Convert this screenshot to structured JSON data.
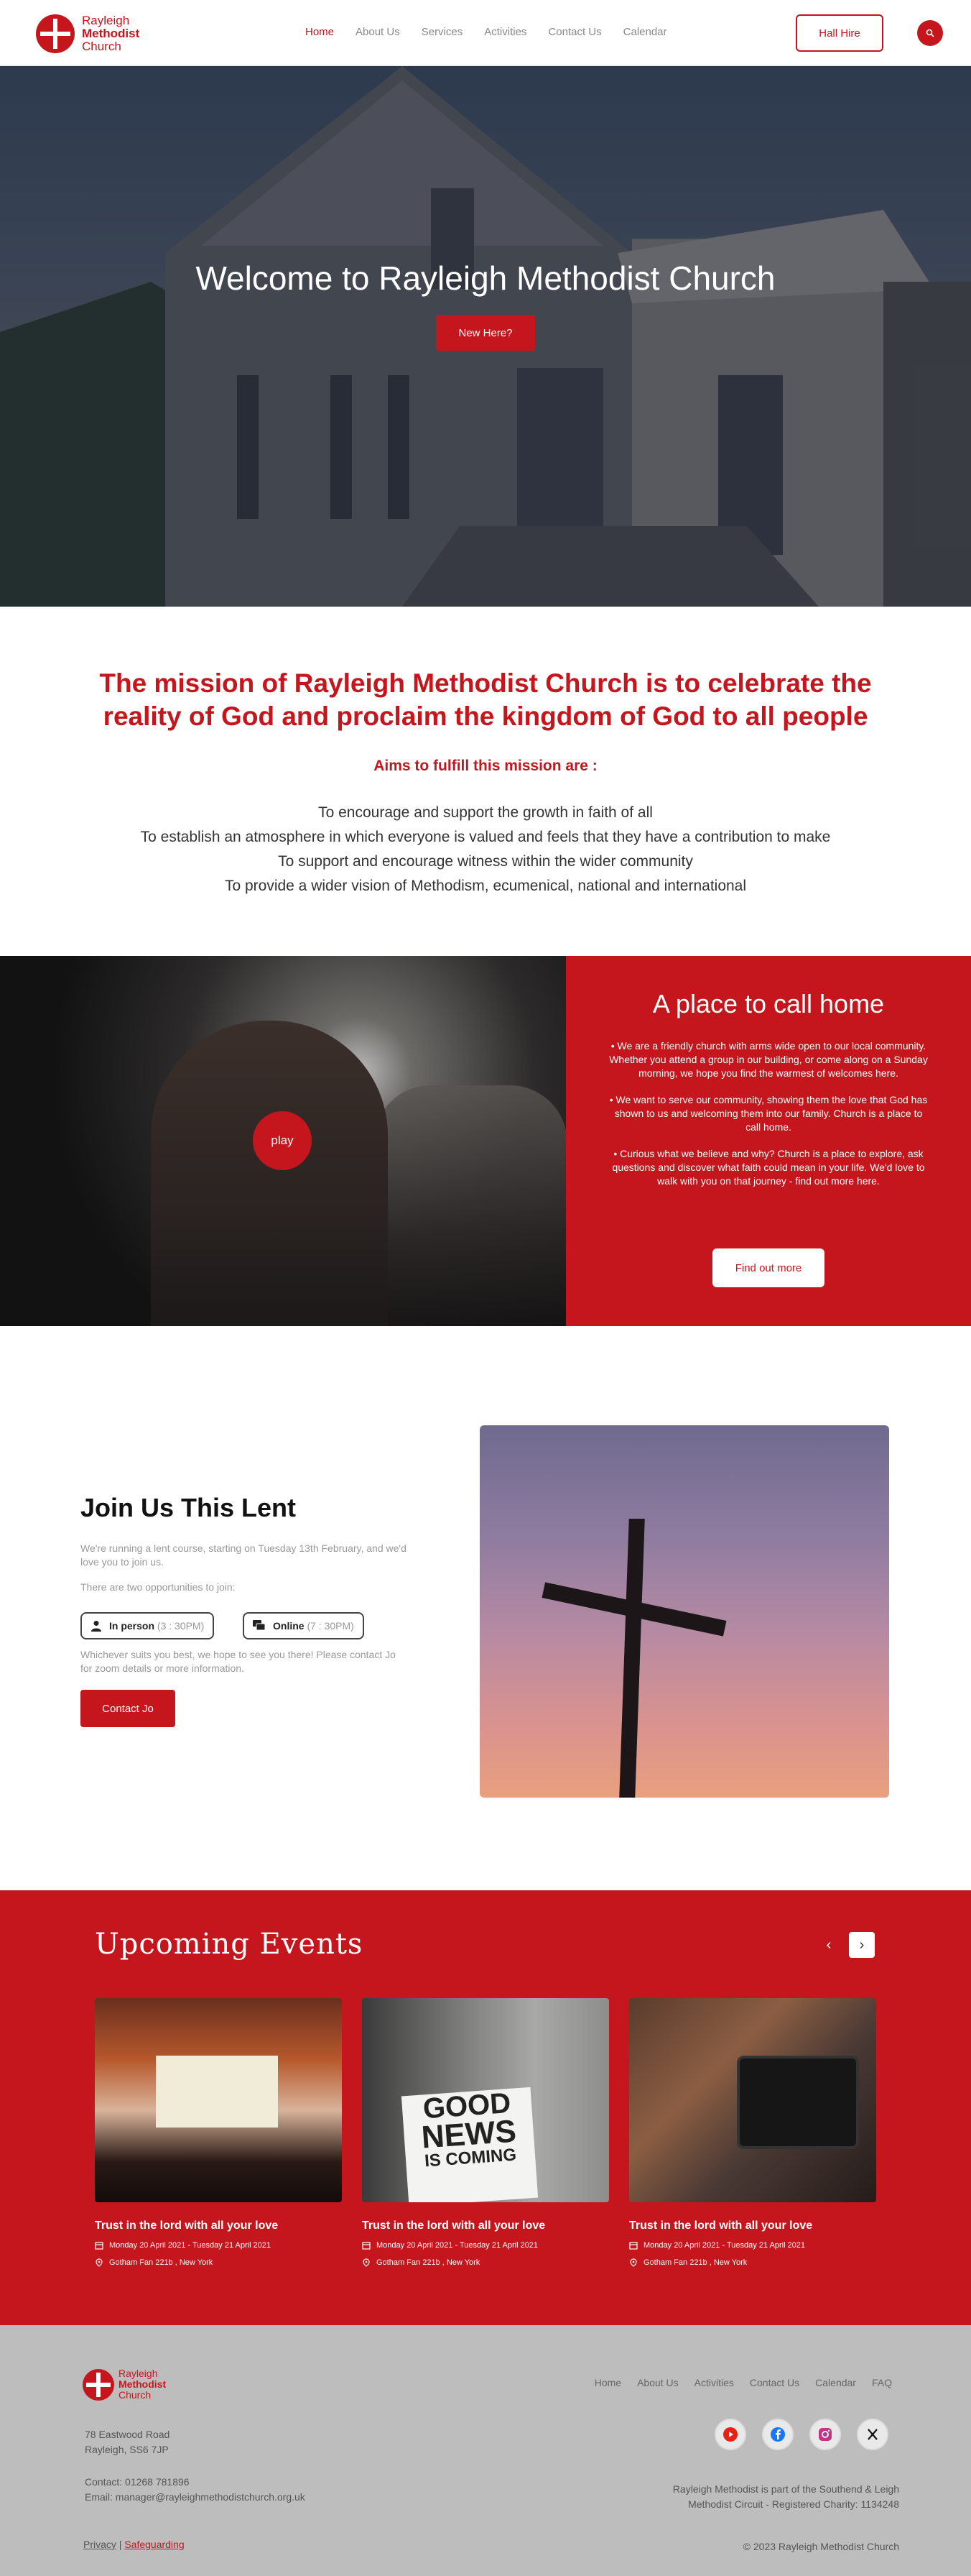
{
  "header": {
    "logo": {
      "line1": "Rayleigh",
      "line2": "Methodist",
      "line3": "Church"
    },
    "nav": [
      "Home",
      "About Us",
      "Services",
      "Activities",
      "Contact Us",
      "Calendar"
    ],
    "hall_hire": "Hall Hire"
  },
  "hero": {
    "title": "Welcome to Rayleigh Methodist Church",
    "button": "New Here?"
  },
  "mission": {
    "heading": "The mission of Rayleigh Methodist Church is to celebrate the reality of God and proclaim the kingdom of God to all people",
    "subheading": "Aims to fulfill this mission are :",
    "aims": [
      "To encourage and support the growth in faith of all",
      "To establish an atmosphere in which everyone is valued and feels that they have a contribution to make",
      "To support and encourage witness within the wider community",
      "To provide a wider vision of Methodism, ecumenical, national and international"
    ]
  },
  "home": {
    "play": "play",
    "title": "A place to call home",
    "bullets": [
      "We are a friendly church with arms wide open to our local community. Whether you attend a group in our building, or come along on a Sunday morning, we hope you find the warmest of welcomes here.",
      "We want to serve our community, showing them the love that God has shown to us and welcoming them into our family. Church is a place to call home.",
      "Curious what we believe and why? Church is a place to explore, ask questions and discover what faith could mean in your life. We'd love to walk with you on that journey - find out more here."
    ],
    "button": "Find out more"
  },
  "lent": {
    "title": "Join Us This Lent",
    "p1": "We're running a lent course, starting on Tuesday 13th February, and we'd love you to join us.",
    "p2": "There are two opportunities to join:",
    "in_person": "In person",
    "in_person_time": "(3 : 30PM)",
    "online": "Online",
    "online_time": "(7 : 30PM)",
    "p3": "Whichever suits you best, we hope to see you there! Please contact Jo for zoom details or more information.",
    "button": "Contact Jo"
  },
  "events": {
    "title": "Upcoming Events",
    "items": [
      {
        "title": "Trust in the lord with all your love",
        "date": "Monday 20 April 2021 - Tuesday 21 April 2021",
        "location": "Gotham Fan 221b , New York"
      },
      {
        "title": "Trust in the lord with all your love",
        "date": "Monday 20 April 2021 - Tuesday 21 April 2021",
        "location": "Gotham Fan 221b , New York"
      },
      {
        "title": "Trust in the lord with all your love",
        "date": "Monday 20 April 2021 - Tuesday 21 April 2021",
        "location": "Gotham Fan 221b , New York"
      }
    ],
    "sign": {
      "l1": "GOOD",
      "l2": "NEWS",
      "l3": "IS COMING"
    }
  },
  "footer": {
    "nav": [
      "Home",
      "About Us",
      "Activities",
      "Contact Us",
      "Calendar",
      "FAQ"
    ],
    "address1": "78 Eastwood Road",
    "address2": "Rayleigh, SS6 7JP",
    "contact": "Contact: 01268 781896",
    "email": "Email: manager@rayleighmethodistchurch.org.uk",
    "reg1": "Rayleigh Methodist is part of the Southend & Leigh",
    "reg2": "Methodist Circuit - Registered Charity: 1134248",
    "privacy": "Privacy",
    "separator": "|",
    "safeguarding": "Safeguarding",
    "copyright": "© 2023 Rayleigh Methodist Church"
  },
  "colors": {
    "brand": "#c4161c",
    "footer_bg": "#bdbdbd"
  },
  "icons": [
    "search-icon",
    "user-icon",
    "chat-icon",
    "calendar-icon",
    "location-pin-icon",
    "youtube-icon",
    "facebook-icon",
    "instagram-icon",
    "x-icon",
    "chevron-left-icon",
    "chevron-right-icon"
  ]
}
